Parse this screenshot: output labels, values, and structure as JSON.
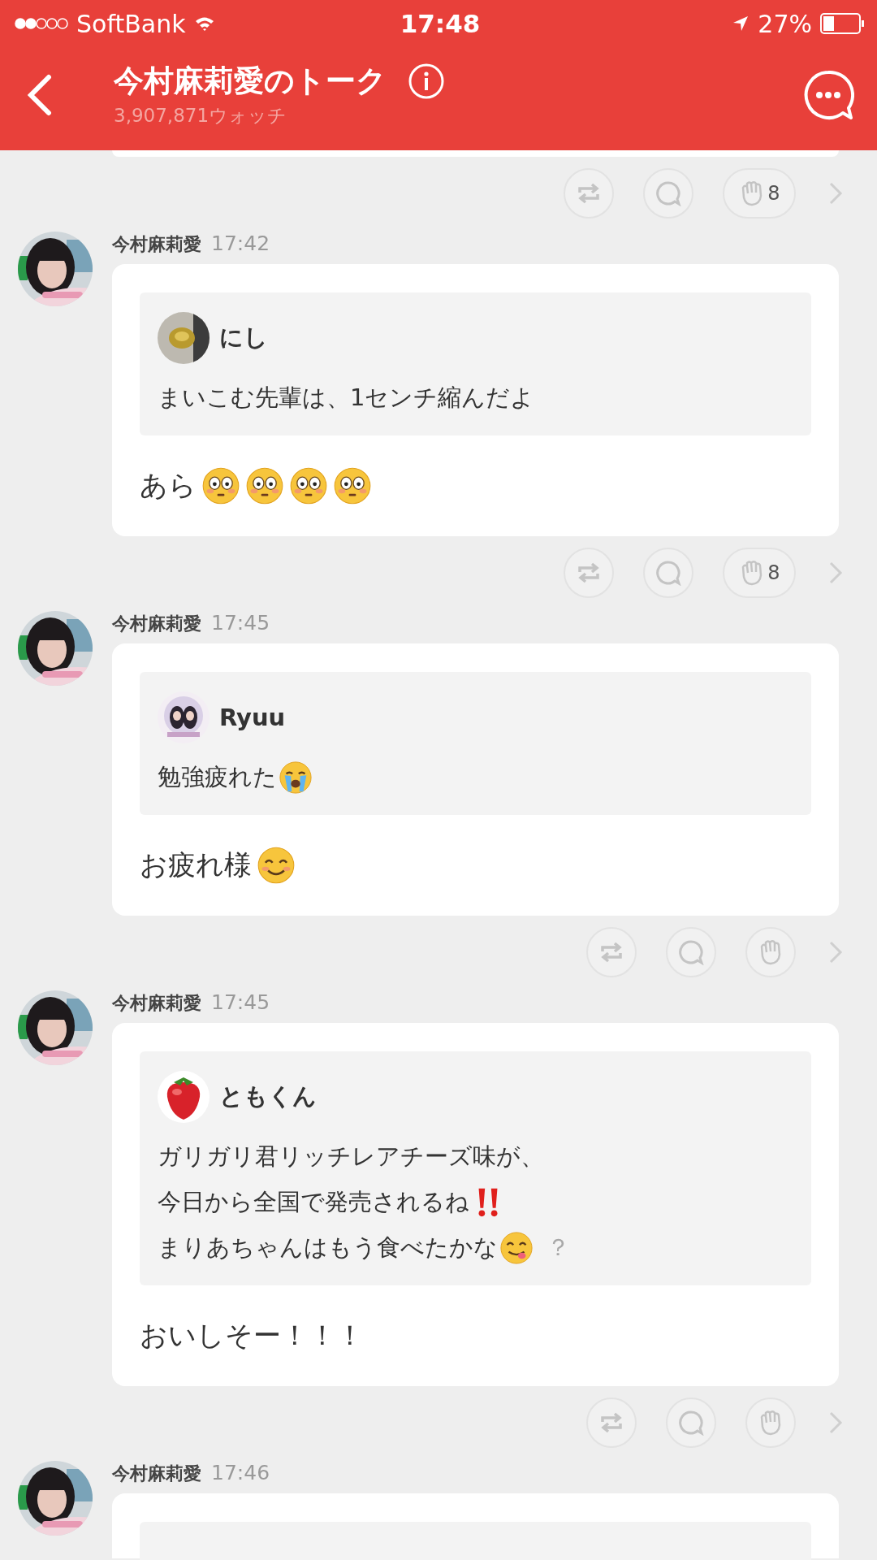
{
  "status_bar": {
    "carrier": "SoftBank",
    "time": "17:48",
    "battery": "27%"
  },
  "header": {
    "title": "今村麻莉愛のトーク",
    "watch_count": "3,907,871ウォッチ"
  },
  "feed": [
    {
      "kind": "actions",
      "clap_count": "8"
    },
    {
      "kind": "post",
      "author": "今村麻莉愛",
      "time": "17:42",
      "quote": {
        "name": "にし",
        "lines": [
          [
            {
              "kind": "text",
              "text": "まいこむ先輩は、1センチ縮んだよ"
            }
          ]
        ]
      },
      "reply": [
        {
          "kind": "text",
          "text": "あら"
        },
        {
          "kind": "flushed"
        },
        {
          "kind": "flushed"
        },
        {
          "kind": "flushed"
        },
        {
          "kind": "flushed"
        }
      ]
    },
    {
      "kind": "actions",
      "clap_count": "8"
    },
    {
      "kind": "post",
      "author": "今村麻莉愛",
      "time": "17:45",
      "quote": {
        "name": "Ryuu",
        "lines": [
          [
            {
              "kind": "text",
              "text": "勉強疲れた"
            },
            {
              "kind": "crying"
            }
          ]
        ]
      },
      "reply": [
        {
          "kind": "text",
          "text": "お疲れ様"
        },
        {
          "kind": "smiling"
        }
      ]
    },
    {
      "kind": "actions"
    },
    {
      "kind": "post",
      "author": "今村麻莉愛",
      "time": "17:45",
      "quote": {
        "name": "ともくん",
        "lines": [
          [
            {
              "kind": "text",
              "text": "ガリガリ君リッチレアチーズ味が、"
            }
          ],
          [
            {
              "kind": "text",
              "text": "今日から全国で発売されるね"
            },
            {
              "kind": "double-exclamation"
            }
          ],
          [
            {
              "kind": "text",
              "text": "まりあちゃんはもう食べたかな"
            },
            {
              "kind": "yum"
            },
            {
              "kind": "faint",
              "text": "？"
            }
          ]
        ]
      },
      "reply": [
        {
          "kind": "text",
          "text": "おいしそー！！！"
        }
      ]
    },
    {
      "kind": "actions"
    },
    {
      "kind": "post",
      "author": "今村麻莉愛",
      "time": "17:46"
    }
  ]
}
